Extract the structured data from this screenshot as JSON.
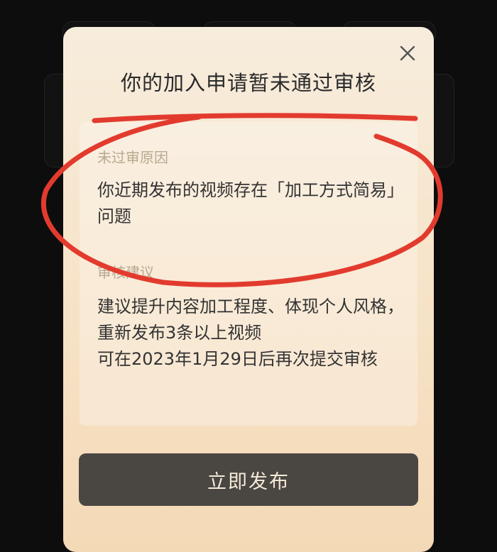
{
  "dialog": {
    "title": "你的加入申请暂未通过审核",
    "reason_label": "未过审原因",
    "reason_text": "你近期发布的视频存在「加工方式简易」问题",
    "suggestion_label": "审核建议",
    "suggestion_text_1": "建议提升内容加工程度、体现个人风格，重新发布3条以上视频",
    "suggestion_text_2": "可在2023年1月29日后再次提交审核",
    "publish_button": "立即发布"
  },
  "icons": {
    "close": "close-icon"
  },
  "colors": {
    "annotation_red": "#e23b2e",
    "button_bg": "#4a4642",
    "button_text": "#f6ebd9",
    "label_color": "#b8a88f"
  }
}
